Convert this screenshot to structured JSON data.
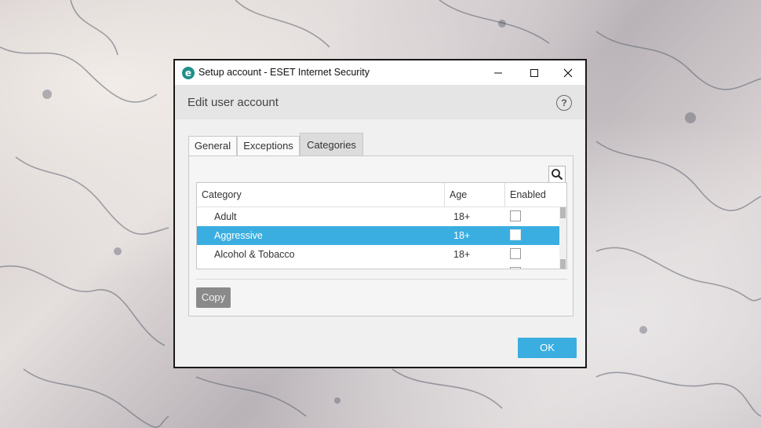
{
  "window": {
    "title": "Setup account - ESET Internet Security",
    "app_icon_letter": "e",
    "accent_color": "#3aaee0"
  },
  "header": {
    "title": "Edit user account",
    "help_label": "?"
  },
  "tabs": [
    {
      "label": "General",
      "active": false
    },
    {
      "label": "Exceptions",
      "active": false
    },
    {
      "label": "Categories",
      "active": true
    }
  ],
  "table": {
    "columns": [
      "Category",
      "Age",
      "Enabled"
    ],
    "rows": [
      {
        "category": "Adult",
        "age": "18+",
        "enabled": false,
        "selected": false
      },
      {
        "category": "Aggressive",
        "age": "18+",
        "enabled": false,
        "selected": true
      },
      {
        "category": "Alcohol & Tobacco",
        "age": "18+",
        "enabled": false,
        "selected": false
      }
    ]
  },
  "buttons": {
    "copy": "Copy",
    "ok": "OK"
  },
  "icons": {
    "search": "search-icon",
    "help": "help-icon",
    "minimize": "minimize-icon",
    "maximize": "maximize-icon",
    "close": "close-icon"
  }
}
